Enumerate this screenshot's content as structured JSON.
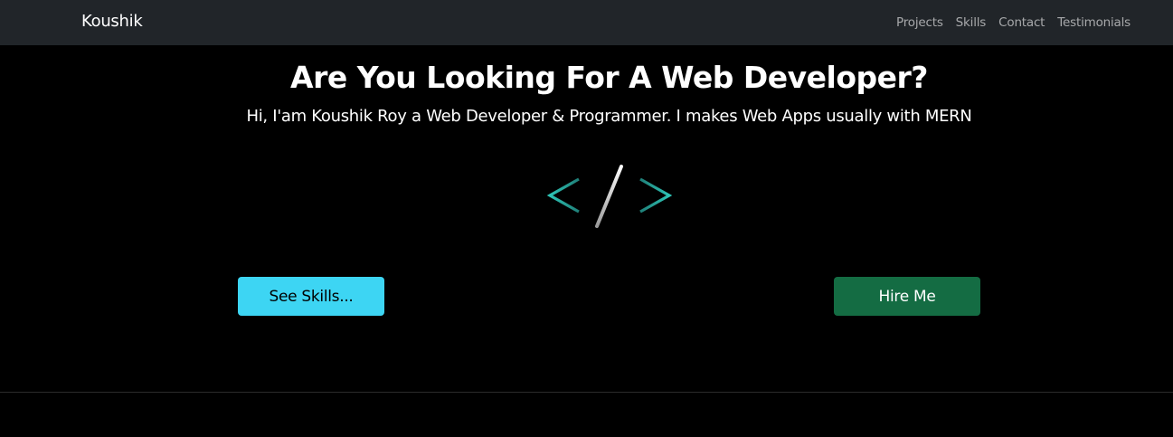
{
  "navbar": {
    "brand": "Koushik",
    "links": [
      "Projects",
      "Skills",
      "Contact",
      "Testimonials"
    ]
  },
  "hero": {
    "title": "Are You Looking For A Web Developer?",
    "subtitle": "Hi, I'am Koushik Roy a Web Developer & Programmer. I makes Web Apps usually with MERN",
    "icon": "code-brackets-icon"
  },
  "buttons": {
    "skills_label": "See Skills...",
    "hire_label": "Hire Me"
  },
  "colors": {
    "navbar_bg": "#212529",
    "page_bg": "#000000",
    "skills_button": "#3dd5f3",
    "hire_button": "#146c43",
    "icon_accent": "#2ec4b6"
  }
}
